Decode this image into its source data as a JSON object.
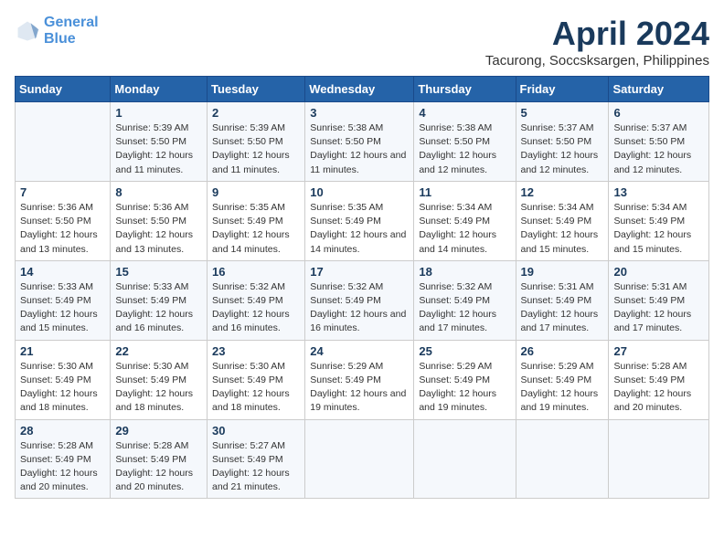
{
  "logo": {
    "line1": "General",
    "line2": "Blue"
  },
  "title": "April 2024",
  "subtitle": "Tacurong, Soccsksargen, Philippines",
  "days_header": [
    "Sunday",
    "Monday",
    "Tuesday",
    "Wednesday",
    "Thursday",
    "Friday",
    "Saturday"
  ],
  "weeks": [
    [
      {
        "day": "",
        "sunrise": "",
        "sunset": "",
        "daylight": ""
      },
      {
        "day": "1",
        "sunrise": "Sunrise: 5:39 AM",
        "sunset": "Sunset: 5:50 PM",
        "daylight": "Daylight: 12 hours and 11 minutes."
      },
      {
        "day": "2",
        "sunrise": "Sunrise: 5:39 AM",
        "sunset": "Sunset: 5:50 PM",
        "daylight": "Daylight: 12 hours and 11 minutes."
      },
      {
        "day": "3",
        "sunrise": "Sunrise: 5:38 AM",
        "sunset": "Sunset: 5:50 PM",
        "daylight": "Daylight: 12 hours and 11 minutes."
      },
      {
        "day": "4",
        "sunrise": "Sunrise: 5:38 AM",
        "sunset": "Sunset: 5:50 PM",
        "daylight": "Daylight: 12 hours and 12 minutes."
      },
      {
        "day": "5",
        "sunrise": "Sunrise: 5:37 AM",
        "sunset": "Sunset: 5:50 PM",
        "daylight": "Daylight: 12 hours and 12 minutes."
      },
      {
        "day": "6",
        "sunrise": "Sunrise: 5:37 AM",
        "sunset": "Sunset: 5:50 PM",
        "daylight": "Daylight: 12 hours and 12 minutes."
      }
    ],
    [
      {
        "day": "7",
        "sunrise": "Sunrise: 5:36 AM",
        "sunset": "Sunset: 5:50 PM",
        "daylight": "Daylight: 12 hours and 13 minutes."
      },
      {
        "day": "8",
        "sunrise": "Sunrise: 5:36 AM",
        "sunset": "Sunset: 5:50 PM",
        "daylight": "Daylight: 12 hours and 13 minutes."
      },
      {
        "day": "9",
        "sunrise": "Sunrise: 5:35 AM",
        "sunset": "Sunset: 5:49 PM",
        "daylight": "Daylight: 12 hours and 14 minutes."
      },
      {
        "day": "10",
        "sunrise": "Sunrise: 5:35 AM",
        "sunset": "Sunset: 5:49 PM",
        "daylight": "Daylight: 12 hours and 14 minutes."
      },
      {
        "day": "11",
        "sunrise": "Sunrise: 5:34 AM",
        "sunset": "Sunset: 5:49 PM",
        "daylight": "Daylight: 12 hours and 14 minutes."
      },
      {
        "day": "12",
        "sunrise": "Sunrise: 5:34 AM",
        "sunset": "Sunset: 5:49 PM",
        "daylight": "Daylight: 12 hours and 15 minutes."
      },
      {
        "day": "13",
        "sunrise": "Sunrise: 5:34 AM",
        "sunset": "Sunset: 5:49 PM",
        "daylight": "Daylight: 12 hours and 15 minutes."
      }
    ],
    [
      {
        "day": "14",
        "sunrise": "Sunrise: 5:33 AM",
        "sunset": "Sunset: 5:49 PM",
        "daylight": "Daylight: 12 hours and 15 minutes."
      },
      {
        "day": "15",
        "sunrise": "Sunrise: 5:33 AM",
        "sunset": "Sunset: 5:49 PM",
        "daylight": "Daylight: 12 hours and 16 minutes."
      },
      {
        "day": "16",
        "sunrise": "Sunrise: 5:32 AM",
        "sunset": "Sunset: 5:49 PM",
        "daylight": "Daylight: 12 hours and 16 minutes."
      },
      {
        "day": "17",
        "sunrise": "Sunrise: 5:32 AM",
        "sunset": "Sunset: 5:49 PM",
        "daylight": "Daylight: 12 hours and 16 minutes."
      },
      {
        "day": "18",
        "sunrise": "Sunrise: 5:32 AM",
        "sunset": "Sunset: 5:49 PM",
        "daylight": "Daylight: 12 hours and 17 minutes."
      },
      {
        "day": "19",
        "sunrise": "Sunrise: 5:31 AM",
        "sunset": "Sunset: 5:49 PM",
        "daylight": "Daylight: 12 hours and 17 minutes."
      },
      {
        "day": "20",
        "sunrise": "Sunrise: 5:31 AM",
        "sunset": "Sunset: 5:49 PM",
        "daylight": "Daylight: 12 hours and 17 minutes."
      }
    ],
    [
      {
        "day": "21",
        "sunrise": "Sunrise: 5:30 AM",
        "sunset": "Sunset: 5:49 PM",
        "daylight": "Daylight: 12 hours and 18 minutes."
      },
      {
        "day": "22",
        "sunrise": "Sunrise: 5:30 AM",
        "sunset": "Sunset: 5:49 PM",
        "daylight": "Daylight: 12 hours and 18 minutes."
      },
      {
        "day": "23",
        "sunrise": "Sunrise: 5:30 AM",
        "sunset": "Sunset: 5:49 PM",
        "daylight": "Daylight: 12 hours and 18 minutes."
      },
      {
        "day": "24",
        "sunrise": "Sunrise: 5:29 AM",
        "sunset": "Sunset: 5:49 PM",
        "daylight": "Daylight: 12 hours and 19 minutes."
      },
      {
        "day": "25",
        "sunrise": "Sunrise: 5:29 AM",
        "sunset": "Sunset: 5:49 PM",
        "daylight": "Daylight: 12 hours and 19 minutes."
      },
      {
        "day": "26",
        "sunrise": "Sunrise: 5:29 AM",
        "sunset": "Sunset: 5:49 PM",
        "daylight": "Daylight: 12 hours and 19 minutes."
      },
      {
        "day": "27",
        "sunrise": "Sunrise: 5:28 AM",
        "sunset": "Sunset: 5:49 PM",
        "daylight": "Daylight: 12 hours and 20 minutes."
      }
    ],
    [
      {
        "day": "28",
        "sunrise": "Sunrise: 5:28 AM",
        "sunset": "Sunset: 5:49 PM",
        "daylight": "Daylight: 12 hours and 20 minutes."
      },
      {
        "day": "29",
        "sunrise": "Sunrise: 5:28 AM",
        "sunset": "Sunset: 5:49 PM",
        "daylight": "Daylight: 12 hours and 20 minutes."
      },
      {
        "day": "30",
        "sunrise": "Sunrise: 5:27 AM",
        "sunset": "Sunset: 5:49 PM",
        "daylight": "Daylight: 12 hours and 21 minutes."
      },
      {
        "day": "",
        "sunrise": "",
        "sunset": "",
        "daylight": ""
      },
      {
        "day": "",
        "sunrise": "",
        "sunset": "",
        "daylight": ""
      },
      {
        "day": "",
        "sunrise": "",
        "sunset": "",
        "daylight": ""
      },
      {
        "day": "",
        "sunrise": "",
        "sunset": "",
        "daylight": ""
      }
    ]
  ]
}
